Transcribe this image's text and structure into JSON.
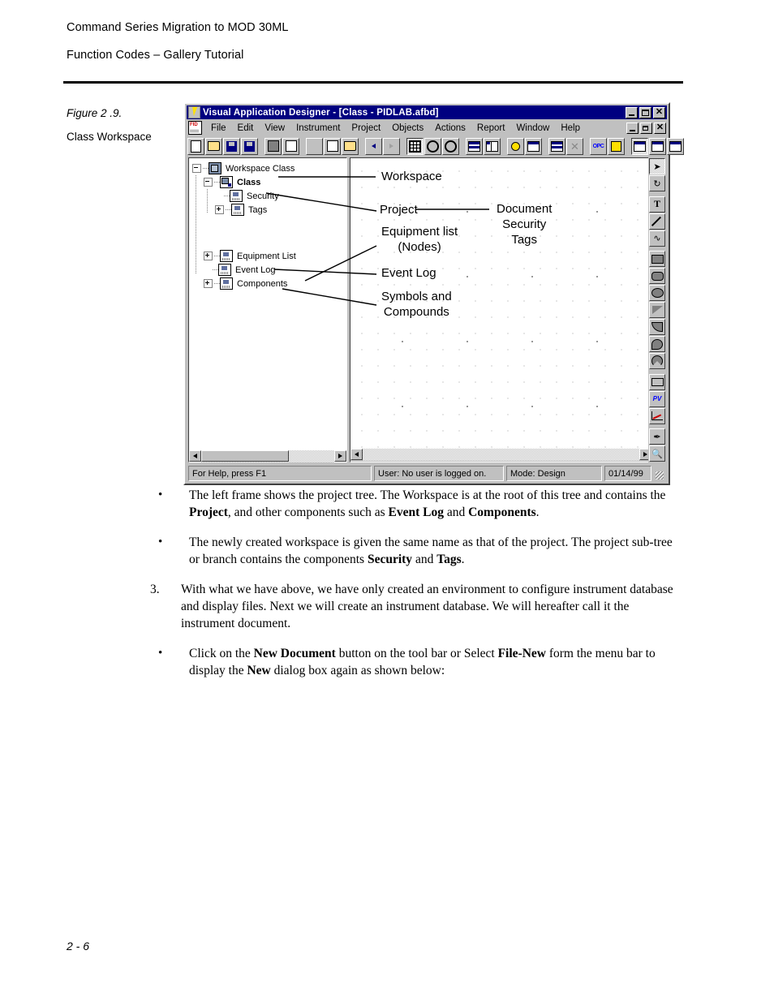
{
  "header": {
    "line1": "Command Series Migration to MOD 30ML",
    "line2": "Function Codes – Gallery Tutorial"
  },
  "figure": {
    "caption_number": "Figure 2 .9.",
    "caption_title": "Class Workspace"
  },
  "app": {
    "title": "Visual Application Designer - [Class - PIDLAB.afbd]",
    "title_icon": "lightning-bolt-icon",
    "window_buttons": [
      "minimize",
      "maximize",
      "close"
    ],
    "mdi_buttons": [
      "minimize",
      "restore",
      "close"
    ],
    "document_icon": "fid-document-icon",
    "menu": [
      "File",
      "Edit",
      "View",
      "Instrument",
      "Project",
      "Objects",
      "Actions",
      "Report",
      "Window",
      "Help"
    ],
    "toolbar": [
      "new-document-icon",
      "open-folder-icon",
      "save-icon",
      "save-all-icon",
      "print-icon",
      "print-preview-icon",
      "cut-icon",
      "copy-icon",
      "paste-icon",
      "undo-icon",
      "redo-icon",
      "grid-icon",
      "zoom-out-icon",
      "zoom-in-icon",
      "horizontal-tile-icon",
      "vertical-tile-icon",
      "tag-icon",
      "properties-icon",
      "sort-icon",
      "delete-icon",
      "opc-icon",
      "wizard-icon",
      "window-cascade-icon",
      "window-list-icon",
      "window-detail-icon"
    ],
    "tree": [
      {
        "label": "Workspace Class",
        "icon": "workspace-icon",
        "expander": "minus",
        "indent": 0,
        "bold": false
      },
      {
        "label": "Class",
        "icon": "class-icon",
        "expander": "minus",
        "indent": 1,
        "bold": true
      },
      {
        "label": "Security",
        "icon": "document-icon",
        "expander": "none",
        "indent": 2,
        "bold": false
      },
      {
        "label": "Tags",
        "icon": "document-icon",
        "expander": "plus",
        "indent": 2,
        "bold": false
      },
      {
        "label": "Equipment List",
        "icon": "document-icon",
        "expander": "plus",
        "indent": 1,
        "bold": false
      },
      {
        "label": "Event Log",
        "icon": "document-icon",
        "expander": "none",
        "indent": 1,
        "bold": false
      },
      {
        "label": "Components",
        "icon": "document-icon",
        "expander": "plus",
        "indent": 1,
        "bold": false
      }
    ],
    "annotations": {
      "workspace": "Workspace",
      "project": "Project",
      "equipment": "Equipment list\n(Nodes)",
      "eventlog": "Event Log",
      "symbols": "Symbols and\nCompounds",
      "project_children": "Document\nSecurity\nTags"
    },
    "palette": [
      "pointer-icon",
      "rotate-icon",
      "text-icon",
      "line-icon",
      "curve-icon",
      "rectangle-icon",
      "rounded-rectangle-icon",
      "ellipse-icon",
      "polygon-icon",
      "arc-icon",
      "pie-icon",
      "pie-slice-icon",
      "button-icon",
      "pv-field-icon",
      "trend-chart-icon",
      "eyedropper-icon",
      "magnifier-icon"
    ],
    "statusbar": {
      "help": "For Help, press F1",
      "user": "User:  No user is logged on.",
      "mode": "Mode:  Design",
      "date": "01/14/99"
    }
  },
  "body": [
    {
      "marker": "•",
      "type": "bullet",
      "parts": [
        {
          "t": "The left frame shows the project tree. The Workspace is at the root of this tree and contains the ",
          "b": false
        },
        {
          "t": "Project",
          "b": true
        },
        {
          "t": ", and other components such as ",
          "b": false
        },
        {
          "t": "Event Log",
          "b": true
        },
        {
          "t": " and ",
          "b": false
        },
        {
          "t": "Components",
          "b": true
        },
        {
          "t": ".",
          "b": false
        }
      ]
    },
    {
      "marker": "•",
      "type": "bullet",
      "parts": [
        {
          "t": "The newly created workspace is given the same name as that of the project. The project sub-tree or branch contains the components ",
          "b": false
        },
        {
          "t": "Security",
          "b": true
        },
        {
          "t": " and ",
          "b": false
        },
        {
          "t": "Tags",
          "b": true
        },
        {
          "t": ".",
          "b": false
        }
      ]
    },
    {
      "marker": "3.",
      "type": "numbered",
      "parts": [
        {
          "t": "With what we have above, we have only created an environment to configure instrument database and display files. Next we will create an instrument database. We will hereafter call it the instrument document.",
          "b": false
        }
      ]
    },
    {
      "marker": "•",
      "type": "bullet",
      "parts": [
        {
          "t": "Click on the ",
          "b": false
        },
        {
          "t": "New Document",
          "b": true
        },
        {
          "t": " button on the tool bar or Select ",
          "b": false
        },
        {
          "t": "File-New",
          "b": true
        },
        {
          "t": " form the menu bar to display the ",
          "b": false
        },
        {
          "t": "New",
          "b": true
        },
        {
          "t": " dialog box again as shown below:",
          "b": false
        }
      ]
    }
  ],
  "footer": {
    "page_number": "2 - 6"
  }
}
